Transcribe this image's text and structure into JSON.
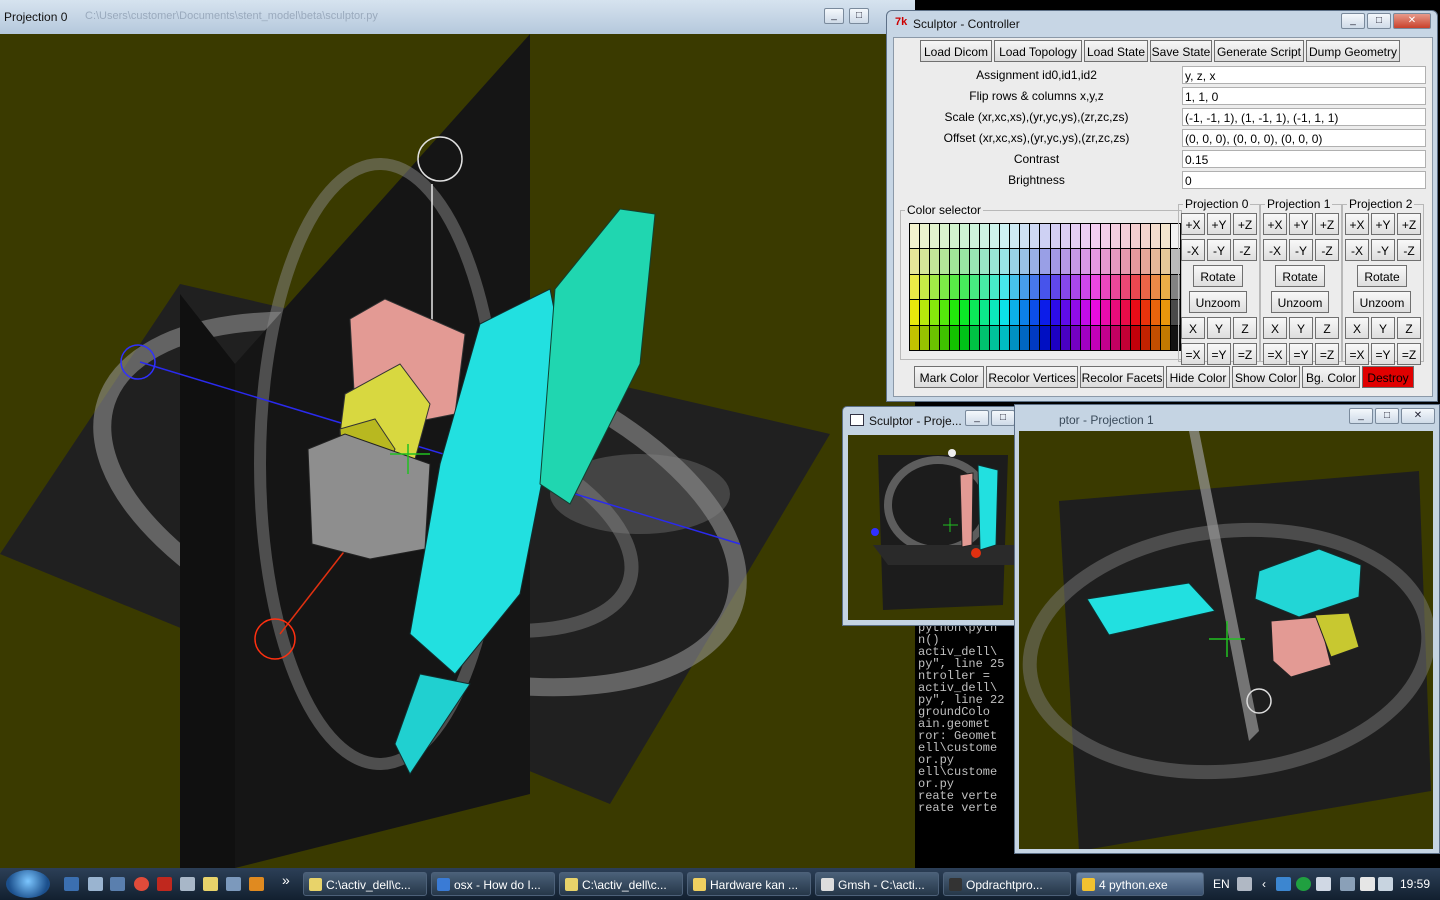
{
  "projection0": {
    "title": "Projection 0",
    "path": "C:\\Users\\customer\\Documents\\stent_model\\beta\\sculptor.py"
  },
  "controller": {
    "title": "Sculptor - Controller",
    "toolbar": [
      "Load Dicom",
      "Load Topology",
      "Load State",
      "Save State",
      "Generate Script",
      "Dump Geometry"
    ],
    "fields": [
      {
        "label": "Assignment id0,id1,id2",
        "value": "y, z, x"
      },
      {
        "label": "Flip rows & columns x,y,z",
        "value": "1, 1, 0"
      },
      {
        "label": "Scale (xr,xc,xs),(yr,yc,ys),(zr,zc,zs)",
        "value": "(-1, -1, 1), (1, -1, 1), (-1, 1, 1)"
      },
      {
        "label": "Offset (xr,xc,xs),(yr,yc,ys),(zr,zc,zs)",
        "value": "(0, 0, 0), (0, 0, 0), (0, 0, 0)"
      },
      {
        "label": "Contrast",
        "value": "0.15"
      },
      {
        "label": "Brightness",
        "value": "0"
      }
    ],
    "color_selector_label": "Color selector",
    "projections": [
      {
        "label": "Projection 0"
      },
      {
        "label": "Projection 1"
      },
      {
        "label": "Projection 2"
      }
    ],
    "proj_buttons": {
      "row1": [
        "+X",
        "+Y",
        "+Z"
      ],
      "row2": [
        "-X",
        "-Y",
        "-Z"
      ],
      "rotate": "Rotate",
      "unzoom": "Unzoom",
      "row3": [
        "X",
        "Y",
        "Z"
      ],
      "row4": [
        "=X",
        "=Y",
        "=Z"
      ]
    },
    "bottom_buttons": [
      "Mark Color",
      "Recolor Vertices",
      "Recolor Facets",
      "Hide Color",
      "Show Color",
      "Bg. Color",
      "Destroy"
    ],
    "destroy_color": "#e00000"
  },
  "projection2": {
    "title": "Sculptor - Proje..."
  },
  "projection1": {
    "title": "ptor - Projection 1"
  },
  "console": {
    "lines": [
      "python\\pyth",
      "n()",
      "activ_dell\\",
      "py\", line 25",
      "ntroller =",
      "activ_dell\\",
      "py\", line 22",
      "groundColo",
      "ain.geomet",
      "ror: Geomet",
      "",
      "ell\\custome",
      "or.py",
      "",
      "ell\\custome",
      "or.py",
      "reate verte",
      "reate verte"
    ]
  },
  "taskbar": {
    "tasks": [
      {
        "label": "C:\\activ_dell\\c...",
        "color": "#e8d36a"
      },
      {
        "label": "osx - How do I...",
        "color": "#3a7bd5"
      },
      {
        "label": "C:\\activ_dell\\c...",
        "color": "#e8d36a"
      },
      {
        "label": "Hardware kan ...",
        "color": "#f0d060"
      },
      {
        "label": "Gmsh - C:\\acti...",
        "color": "#dddddd"
      },
      {
        "label": "Opdrachtpro...",
        "color": "#333333"
      },
      {
        "label": "4 python.exe",
        "color": "#f2c230"
      }
    ],
    "language": "EN",
    "clock": "19:59"
  }
}
